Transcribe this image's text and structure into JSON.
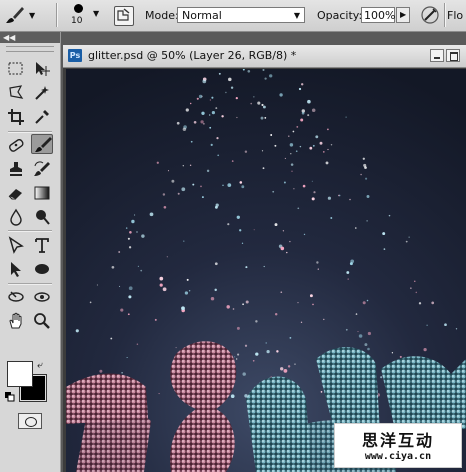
{
  "options_bar": {
    "brush_size": "10",
    "mode_label": "Mode:",
    "mode_value": "Normal",
    "opacity_label": "Opacity:",
    "opacity_value": "100%",
    "flow_label": "Flo"
  },
  "document": {
    "title": "glitter.psd @ 50% (Layer 26, RGB/8) *",
    "app_badge": "Ps"
  },
  "toolbox": {
    "foreground_color": "#ffffff",
    "background_color": "#000000",
    "active_tool": "brush-tool"
  },
  "watermark": {
    "chinese": "思洋互动",
    "url": "www.ciya.cn"
  }
}
